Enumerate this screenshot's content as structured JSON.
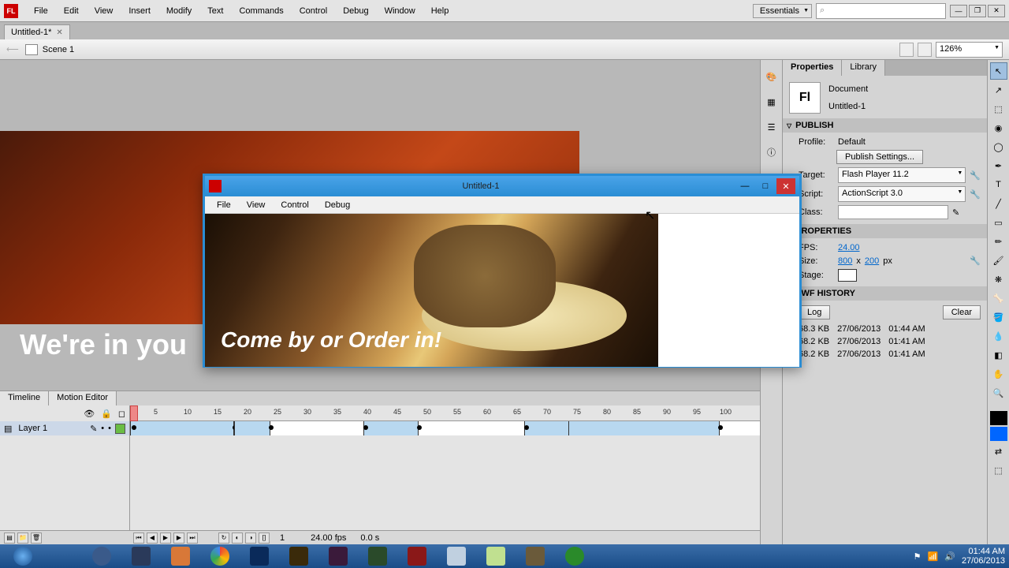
{
  "menubar": {
    "items": [
      "File",
      "Edit",
      "View",
      "Insert",
      "Modify",
      "Text",
      "Commands",
      "Control",
      "Debug",
      "Window",
      "Help"
    ],
    "workspace": "Essentials"
  },
  "doctab": {
    "title": "Untitled-1*"
  },
  "scene": {
    "name": "Scene 1",
    "zoom": "126%"
  },
  "stage": {
    "text_visible": "We're in you"
  },
  "swf": {
    "title": "Untitled-1",
    "menu": [
      "File",
      "View",
      "Control",
      "Debug"
    ],
    "caption": "Come by or Order in!"
  },
  "timeline": {
    "tabs": [
      "Timeline",
      "Motion Editor"
    ],
    "layer": "Layer 1",
    "ticks": [
      5,
      10,
      15,
      20,
      25,
      30,
      35,
      40,
      45,
      50,
      55,
      60,
      65,
      70,
      75,
      80,
      85,
      90,
      95,
      100
    ],
    "status": {
      "frame": "1",
      "fps": "24.00 fps",
      "time": "0.0 s"
    }
  },
  "panels": {
    "tabs": [
      "Properties",
      "Library"
    ],
    "doc_type": "Document",
    "doc_name": "Untitled-1",
    "publish": {
      "title": "PUBLISH",
      "profile_label": "Profile:",
      "profile": "Default",
      "settings_btn": "Publish Settings...",
      "target_label": "Target:",
      "target": "Flash Player 11.2",
      "script_label": "Script:",
      "script": "ActionScript 3.0",
      "class_label": "Class:"
    },
    "properties": {
      "title": "PROPERTIES",
      "fps_label": "FPS:",
      "fps": "24.00",
      "size_label": "Size:",
      "w": "800",
      "h": "200",
      "x_sep": "x",
      "unit": "px",
      "stage_label": "Stage:"
    },
    "history": {
      "title": "SWF HISTORY",
      "log": "Log",
      "clear": "Clear",
      "rows": [
        {
          "size": "68.3 KB",
          "date": "27/06/2013",
          "time": "01:44 AM"
        },
        {
          "size": "68.2 KB",
          "date": "27/06/2013",
          "time": "01:41 AM"
        },
        {
          "size": "68.2 KB",
          "date": "27/06/2013",
          "time": "01:41 AM"
        }
      ]
    }
  },
  "taskbar": {
    "apps": [
      {
        "color": "#2b7cd3"
      },
      {
        "color": "#f0c968"
      },
      {
        "color": "#3a5a8a"
      },
      {
        "color": "#2a3a5a"
      },
      {
        "color": "#d87838"
      },
      {
        "color": "#35a853"
      },
      {
        "color": "#0a2a5a"
      },
      {
        "color": "#3a2a0a"
      },
      {
        "color": "#3a1a3a"
      },
      {
        "color": "#2a4a2a"
      },
      {
        "color": "#8a1818"
      },
      {
        "color": "#c0d0e0"
      },
      {
        "color": "#c0e090"
      },
      {
        "color": "#6a5a3a"
      },
      {
        "color": "#2a8a2a"
      }
    ],
    "time": "01:44 AM",
    "date": "27/06/2013"
  }
}
